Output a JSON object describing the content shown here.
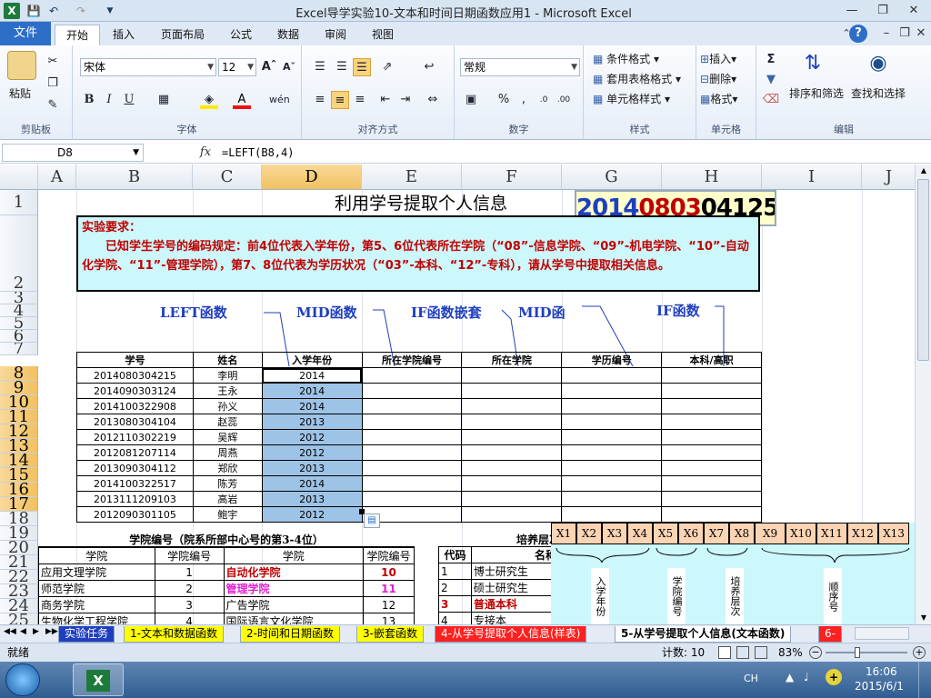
{
  "window": {
    "title": "Excel导学实验10-文本和时间日期函数应用1 - Microsoft Excel"
  },
  "ribbon": {
    "tabs": [
      "文件",
      "开始",
      "插入",
      "页面布局",
      "公式",
      "数据",
      "审阅",
      "视图"
    ],
    "groups": {
      "clipboard": {
        "label": "剪贴板",
        "paste": "粘贴"
      },
      "font": {
        "label": "字体",
        "name": "宋体",
        "size": "12",
        "bold": "B",
        "italic": "I",
        "underline": "U"
      },
      "alignment": {
        "label": "对齐方式"
      },
      "number": {
        "label": "数字",
        "format": "常规"
      },
      "styles": {
        "label": "样式",
        "cond": "条件格式",
        "table": "套用表格格式",
        "cell": "单元格样式"
      },
      "cells": {
        "label": "单元格",
        "insert": "插入",
        "delete": "删除",
        "format": "格式"
      },
      "editing": {
        "label": "编辑",
        "sort": "排序和筛选",
        "find": "查找和选择"
      }
    }
  },
  "formula_bar": {
    "name_box": "D8",
    "fx": "fx",
    "formula": "=LEFT(B8,4)"
  },
  "columns": [
    "A",
    "B",
    "C",
    "D",
    "E",
    "F",
    "G",
    "H",
    "I",
    "J"
  ],
  "rows": [
    "1",
    "2",
    "3",
    "4",
    "5",
    "6",
    "7",
    "8",
    "9",
    "10",
    "11",
    "12",
    "13",
    "14",
    "15",
    "16",
    "17",
    "18",
    "19",
    "20",
    "21",
    "22",
    "23",
    "24",
    "25"
  ],
  "sheet": {
    "title": "利用学号提取个人信息",
    "sample_id": {
      "a": "2014",
      "b": "08",
      "c": "03",
      "d": "04125"
    },
    "req_title": "实验要求：",
    "req_body": "已知学生学号的编码规定：前4位代表入学年份，第5、6位代表所在学院（“08”-信息学院、“09”-机电学院、“10”-自动化学院、“11”-管理学院），第7、8位代表为学历状况（“03”-本科、“12”-专科），请从学号中提取相关信息。",
    "callouts": [
      "LEFT函数",
      "MID函数",
      "IF函数嵌套",
      "MID函",
      "IF函数"
    ],
    "headers": [
      "学号",
      "姓名",
      "入学年份",
      "所在学院编号",
      "所在学院",
      "学历编号",
      "本科/高职"
    ],
    "students": [
      {
        "id": "2014080304215",
        "name": "李明",
        "year": "2014"
      },
      {
        "id": "2014090303124",
        "name": "王永",
        "year": "2014"
      },
      {
        "id": "2014100322908",
        "name": "孙义",
        "year": "2014"
      },
      {
        "id": "2013080304104",
        "name": "赵蕊",
        "year": "2013"
      },
      {
        "id": "2012110302219",
        "name": "吴辉",
        "year": "2012"
      },
      {
        "id": "2012081207114",
        "name": "周燕",
        "year": "2012"
      },
      {
        "id": "2013090304112",
        "name": "郑欣",
        "year": "2013"
      },
      {
        "id": "2014100322517",
        "name": "陈芳",
        "year": "2014"
      },
      {
        "id": "2013111209103",
        "name": "高岩",
        "year": "2013"
      },
      {
        "id": "2012090301105",
        "name": "鲍宇",
        "year": "2012"
      }
    ],
    "college_table": {
      "title": "学院编号（院系所部中心号的第3-4位）",
      "headers": [
        "学院",
        "学院编号",
        "学院",
        "学院编号"
      ],
      "rows": [
        [
          "应用文理学院",
          "1",
          "自动化学院",
          "10"
        ],
        [
          "师范学院",
          "2",
          "管理学院",
          "11"
        ],
        [
          "商务学院",
          "3",
          "广告学院",
          "12"
        ],
        [
          "生物化学工程学院",
          "4",
          "国际语言文化学院",
          "13"
        ]
      ]
    },
    "level_table": {
      "title": "培养层次",
      "headers": [
        "代码",
        "名称"
      ],
      "rows": [
        [
          "1",
          "博士研究生"
        ],
        [
          "2",
          "硕士研究生"
        ],
        [
          "3",
          "普通本科"
        ],
        [
          "4",
          "专接本"
        ]
      ]
    },
    "digits": [
      "X1",
      "X2",
      "X3",
      "X4",
      "X5",
      "X6",
      "X7",
      "X8",
      "X9",
      "X10",
      "X11",
      "X12",
      "X13"
    ],
    "digit_labels": [
      "入学年份",
      "学院编号",
      "培养层次",
      "顺序号"
    ]
  },
  "sheet_tabs": [
    "实验任务",
    "1-文本和数据函数",
    "2-时间和日期函数",
    "3-嵌套函数",
    "4-从学号提取个人信息(样表)",
    "5-从学号提取个人信息(文本函数)",
    "6-"
  ],
  "status": {
    "ready": "就绪",
    "count": "计数: 10",
    "zoom": "83%"
  },
  "taskbar": {
    "time": "16:06",
    "date": "2015/6/1",
    "lang": "CH"
  },
  "colors": {
    "accent_blue": "#2d6ec7",
    "req_bg": "#ccf7fb",
    "req_text": "#c00000",
    "callout_blue": "#1f3fbf",
    "selection": "#9dc3e6",
    "digit_bg": "#fbd4b4"
  }
}
